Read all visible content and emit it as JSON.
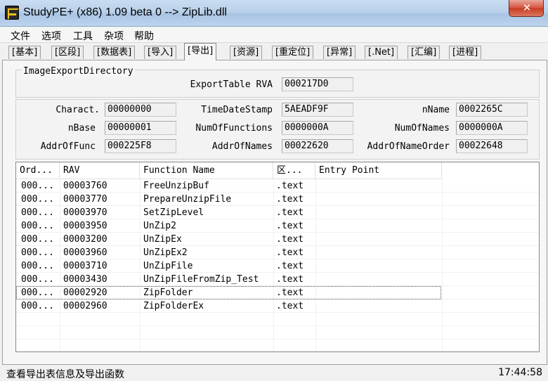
{
  "window": {
    "title": "StudyPE+ (x86) 1.09 beta 0  --> ZipLib.dll",
    "close_glyph": "✕"
  },
  "menu": {
    "items": [
      "文件",
      "选项",
      "工具",
      "杂项",
      "帮助"
    ]
  },
  "tabs": [
    "[基本]",
    "[区段]",
    "[数据表]",
    "[导入]",
    "[导出]",
    "[资源]",
    "[重定位]",
    "[异常]",
    "[.Net]",
    "[汇编]",
    "[进程]"
  ],
  "active_tab": "[导出]",
  "export_dir": {
    "group_label": "ImageExportDirectory",
    "table_rva_label": "ExportTable RVA",
    "table_rva_value": "000217D0",
    "fields": {
      "charact": {
        "label": "Charact.",
        "value": "00000000"
      },
      "timedatestamp": {
        "label": "TimeDateStamp",
        "value": "5AEADF9F"
      },
      "nname": {
        "label": "nName",
        "value": "0002265C"
      },
      "nbase": {
        "label": "nBase",
        "value": "00000001"
      },
      "numoffunctions": {
        "label": "NumOfFunctions",
        "value": "0000000A"
      },
      "numofnames": {
        "label": "NumOfNames",
        "value": "0000000A"
      },
      "addroffunc": {
        "label": "AddrOfFunc",
        "value": "000225F8"
      },
      "addrofnames": {
        "label": "AddrOfNames",
        "value": "00022620"
      },
      "addrofnameorder": {
        "label": "AddrOfNameOrder",
        "value": "00022648"
      }
    }
  },
  "list": {
    "columns": [
      "Ord...",
      "RAV",
      "Function Name",
      "区...",
      "Entry Point"
    ],
    "rows": [
      [
        "000...",
        "00003760",
        "FreeUnzipBuf",
        ".text",
        ""
      ],
      [
        "000...",
        "00003770",
        "PrepareUnzipFile",
        ".text",
        ""
      ],
      [
        "000...",
        "00003970",
        "SetZipLevel",
        ".text",
        ""
      ],
      [
        "000...",
        "00003950",
        "UnZip2",
        ".text",
        ""
      ],
      [
        "000...",
        "00003200",
        "UnZipEx",
        ".text",
        ""
      ],
      [
        "000...",
        "00003960",
        "UnZipEx2",
        ".text",
        ""
      ],
      [
        "000...",
        "00003710",
        "UnZipFile",
        ".text",
        ""
      ],
      [
        "000...",
        "00003430",
        "UnZipFileFromZip_Test",
        ".text",
        ""
      ],
      [
        "000...",
        "00002920",
        "ZipFolder",
        ".text",
        ""
      ],
      [
        "000...",
        "00002960",
        "ZipFolderEx",
        ".text",
        ""
      ]
    ],
    "focused_row": 8
  },
  "status": {
    "text": "查看导出表信息及导出函数",
    "time": "17:44:58"
  }
}
